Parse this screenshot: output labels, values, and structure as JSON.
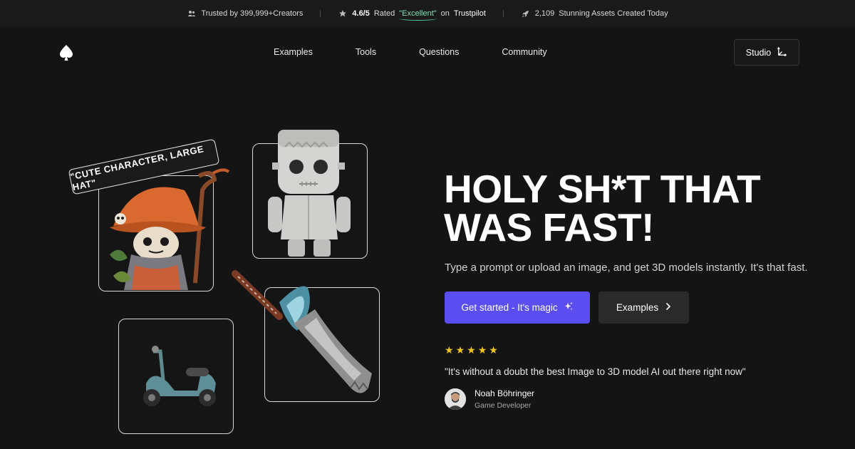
{
  "topbar": {
    "trusted": "Trusted by 399,999+Creators",
    "rating_score": "4.6/5",
    "rated_label": "Rated",
    "rated_word": "\"Excellent\"",
    "on_label": "on",
    "trustpilot": "Trustpilot",
    "assets_count": "2,109",
    "assets_label": "Stunning Assets Created Today",
    "icons": [
      "users-icon",
      "star-icon",
      "rocket-icon"
    ]
  },
  "nav": {
    "items": [
      "Examples",
      "Tools",
      "Questions",
      "Community"
    ],
    "studio_label": "Studio"
  },
  "hero": {
    "prompt_tag": "\"CUTE CHARACTER, LARGE HAT\"",
    "headline": "HOLY SH*T THAT WAS FAST!",
    "subtext": "Type a prompt or upload an image, and get 3D models instantly. It's that fast.",
    "cta_primary": "Get started - It's magic",
    "cta_secondary": "Examples",
    "rating_stars": 5,
    "quote": "\"It's without a doubt the best Image to 3D model AI out there right now\"",
    "author_name": "Noah Böhringer",
    "author_role": "Game Developer"
  },
  "colors": {
    "background": "#141414",
    "accent": "#5b4ef0",
    "star": "#f5c518",
    "excellent": "#7fe0b4"
  }
}
